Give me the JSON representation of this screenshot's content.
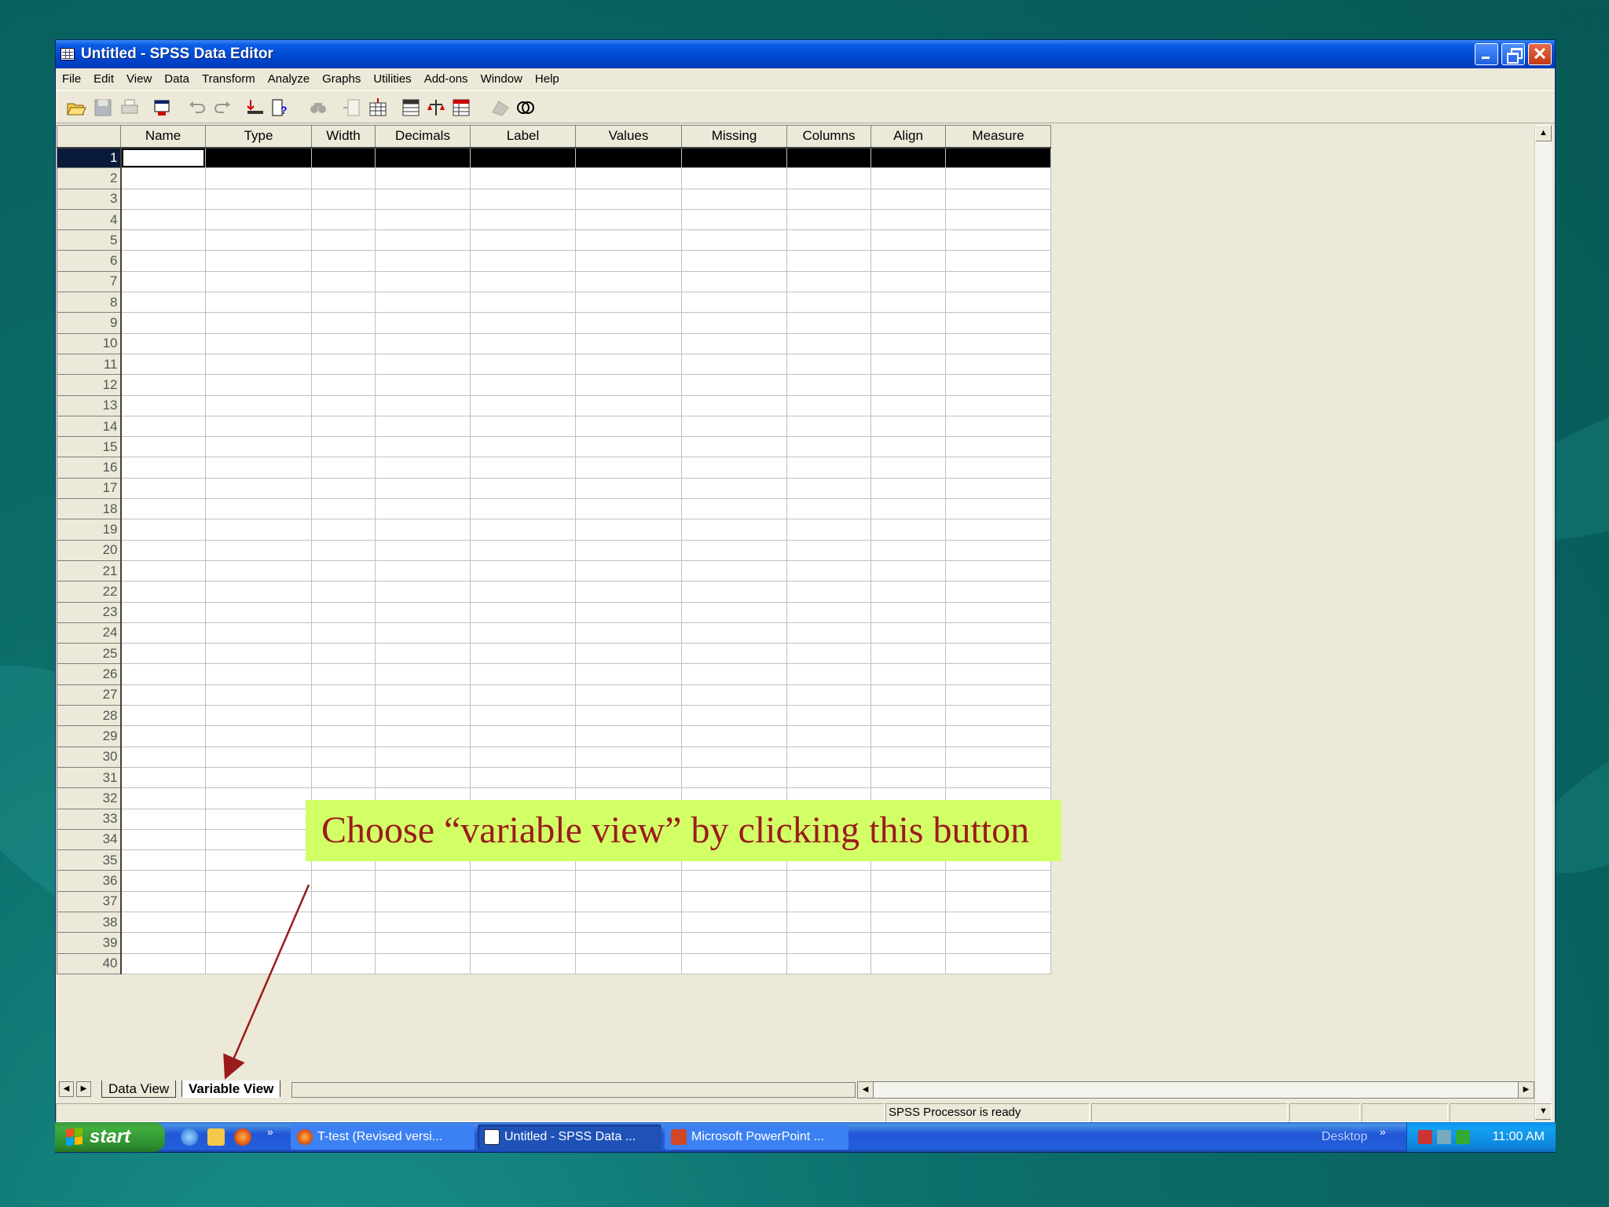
{
  "window": {
    "title": "Untitled - SPSS Data Editor"
  },
  "menubar": {
    "items": [
      "File",
      "Edit",
      "View",
      "Data",
      "Transform",
      "Analyze",
      "Graphs",
      "Utilities",
      "Add-ons",
      "Window",
      "Help"
    ]
  },
  "toolbar": {
    "buttons": [
      "open-icon",
      "save-icon",
      "print-icon",
      "dialog-recall-icon",
      "undo-icon",
      "redo-icon",
      "goto-case-icon",
      "variables-icon",
      "find-icon",
      "insert-cases-icon",
      "insert-variable-icon",
      "split-file-icon",
      "weight-cases-icon",
      "select-cases-icon",
      "value-labels-icon",
      "use-sets-icon"
    ]
  },
  "grid": {
    "columns": [
      "Name",
      "Type",
      "Width",
      "Decimals",
      "Label",
      "Values",
      "Missing",
      "Columns",
      "Align",
      "Measure"
    ],
    "rows": [
      "1",
      "2",
      "3",
      "4",
      "5",
      "6",
      "7",
      "8",
      "9",
      "10",
      "11",
      "12",
      "13",
      "14",
      "15",
      "16",
      "17",
      "18",
      "19",
      "20",
      "21",
      "22",
      "23",
      "24",
      "25",
      "26",
      "27",
      "28",
      "29",
      "30",
      "31",
      "32",
      "33",
      "34",
      "35",
      "36",
      "37",
      "38",
      "39",
      "40"
    ],
    "selected_row": "1"
  },
  "tabs": {
    "data_view": "Data View",
    "variable_view": "Variable View",
    "active": "Variable View"
  },
  "statusbar": {
    "processor": "SPSS Processor  is ready"
  },
  "taskbar": {
    "start": "start",
    "tasks": [
      {
        "label": "T-test (Revised versi..."
      },
      {
        "label": "Untitled - SPSS Data ..."
      },
      {
        "label": "Microsoft PowerPoint ..."
      }
    ],
    "desktop_label": "Desktop",
    "clock": "11:00 AM"
  },
  "callout": {
    "text": "Choose “variable view” by clicking this button"
  },
  "colors": {
    "callout_bg": "#d2ff66",
    "callout_text": "#9b1b1b",
    "titlebar": "#0047d0",
    "background": "#086260"
  }
}
